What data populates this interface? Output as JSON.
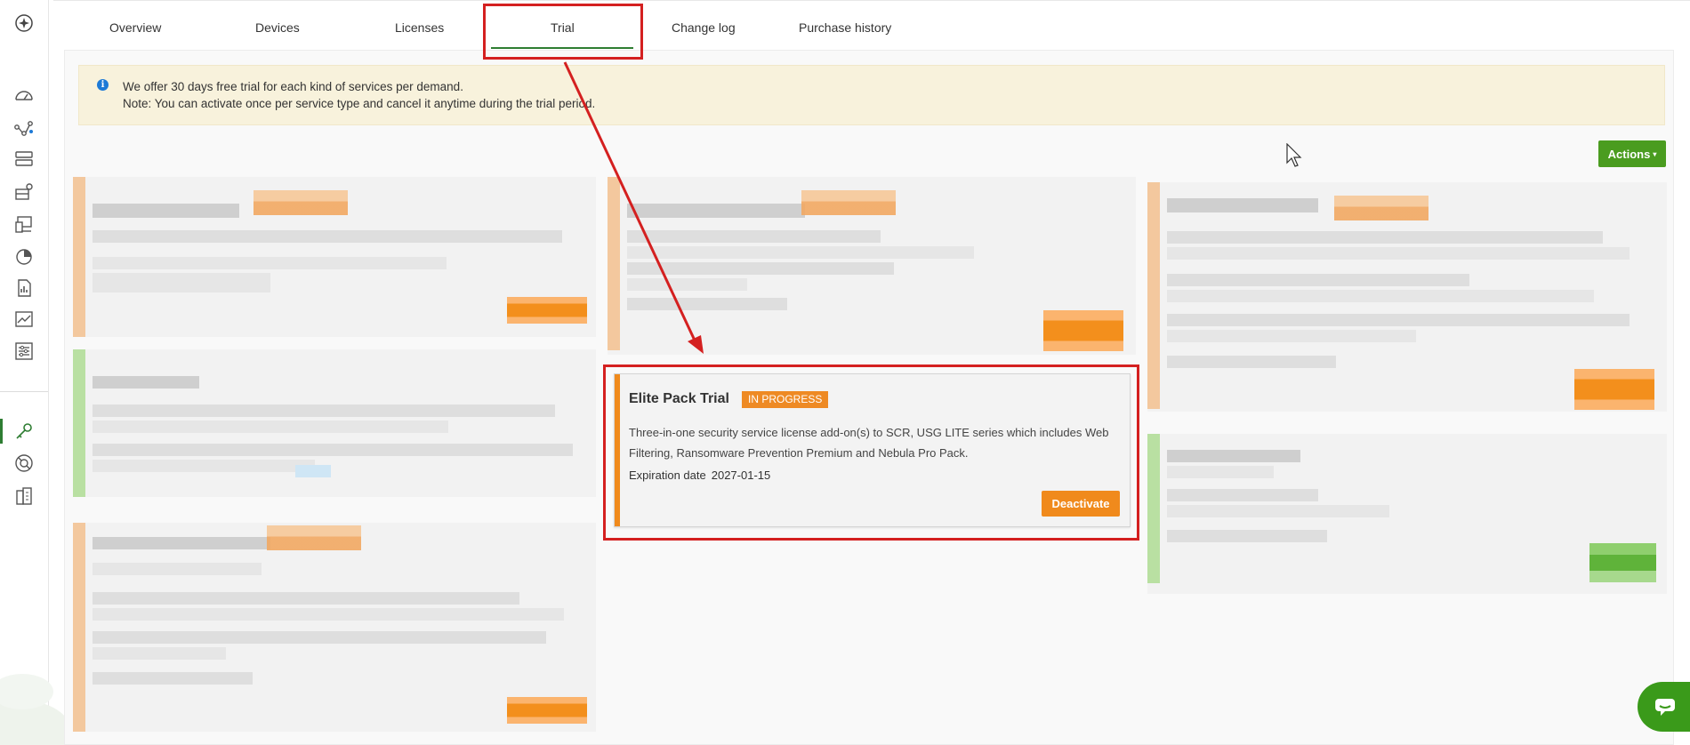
{
  "tabs": [
    {
      "label": "Overview"
    },
    {
      "label": "Devices"
    },
    {
      "label": "Licenses"
    },
    {
      "label": "Trial",
      "active": true
    },
    {
      "label": "Change log"
    },
    {
      "label": "Purchase history"
    }
  ],
  "banner": {
    "line1": "We offer 30 days free trial for each kind of services per demand.",
    "line2": "Note: You can activate once per service type and cancel it anytime during the trial period.",
    "icon": "info-icon"
  },
  "actions": {
    "label": "Actions",
    "caret": "▾"
  },
  "elite_card": {
    "title": "Elite Pack Trial",
    "status": "IN PROGRESS",
    "description": "Three-in-one security service license add-on(s) to SCR, USG LITE series which includes Web Filtering, Ransomware Prevention Premium and Nebula Pro Pack.",
    "expiration_label": "Expiration date",
    "expiration_value": "2027-01-15",
    "button_label": "Deactivate"
  },
  "sidebar": {
    "icons": [
      "nebula-logo-icon",
      "dashboard-icon",
      "topology-icon",
      "devices-icon",
      "site-icon",
      "monitor-icon",
      "analytics-icon",
      "reports-icon",
      "trend-icon",
      "settings-icon",
      "license-key-icon",
      "support-icon",
      "organization-icon"
    ]
  },
  "colors": {
    "accent_green": "#4a9c1f",
    "accent_orange": "#f08a1c",
    "highlight_red": "#d42020",
    "banner_bg": "#f8f2dc"
  }
}
